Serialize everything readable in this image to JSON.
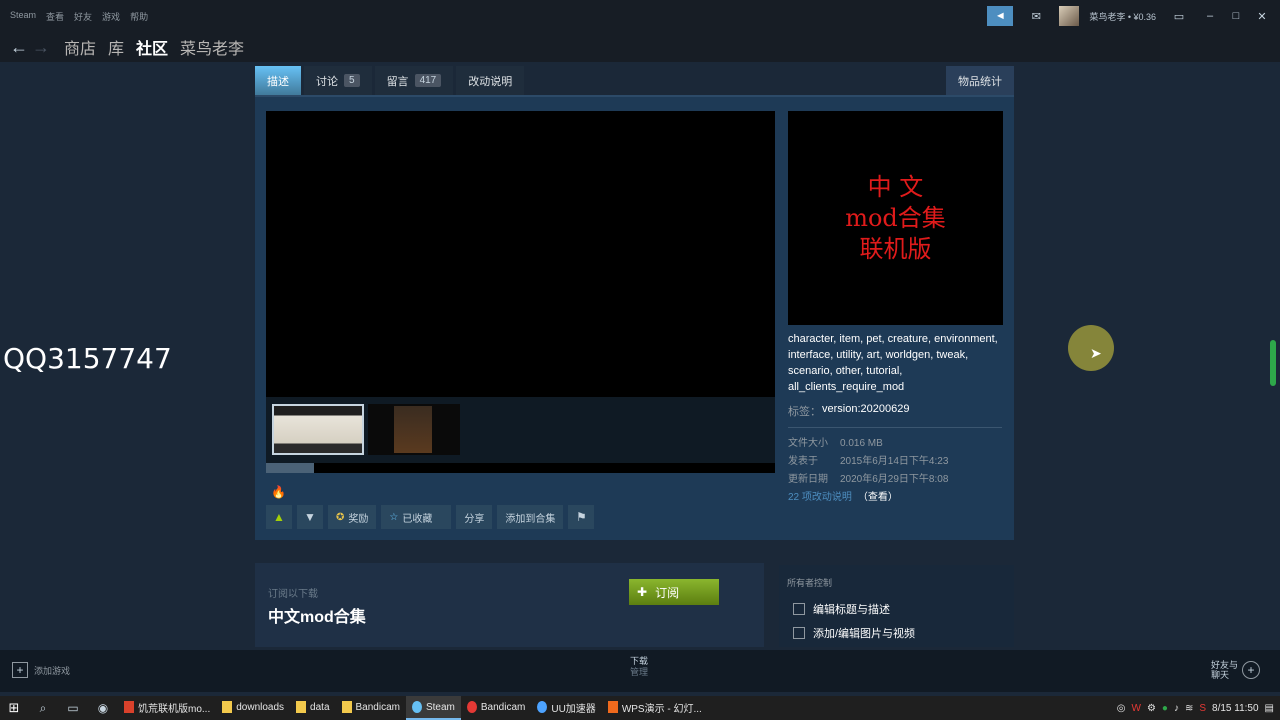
{
  "titlebar": {
    "menu": [
      "Steam",
      "查看",
      "好友",
      "游戏",
      "帮助"
    ],
    "username": "菜鸟老李 • ¥0.36",
    "icons": [
      "announce-icon",
      "mail-icon"
    ],
    "window_controls": [
      "minimize",
      "maximize",
      "close"
    ]
  },
  "nav": {
    "links": [
      "商店",
      "库",
      "社区",
      "菜鸟老李"
    ],
    "active": "社区"
  },
  "watermark": "QQ3157747",
  "tabs": {
    "describe": "描述",
    "discuss": "讨论",
    "discuss_count": "5",
    "comments": "留言",
    "comments_count": "417",
    "changes": "改动说明",
    "stats": "物品统计"
  },
  "preview": {
    "line1": "中 文",
    "line2": "mod合集",
    "line3": "联机版"
  },
  "tags": {
    "list": "character, item, pet, creature, environment, interface, utility, art, worldgen, tweak, scenario, other, tutorial, all_clients_require_mod",
    "label": "标签：",
    "value": "version:20200629"
  },
  "stats": {
    "size_label": "文件大小",
    "size_value": "0.016 MB",
    "posted_label": "发表于",
    "posted_value": "2015年6月14日下午4:23",
    "updated_label": "更新日期",
    "updated_value": "2020年6月29日下午8:08",
    "changes_link": "22 项改动说明",
    "changes_view": "（查看）"
  },
  "actions": {
    "award": "奖励",
    "favorited": "已收藏",
    "share": "分享",
    "add_collection": "添加到合集"
  },
  "subscribe": {
    "label": "订阅以下载",
    "title": "中文mod合集",
    "button": "订阅"
  },
  "owner": {
    "title": "所有者控制",
    "edit_title": "编辑标题与描述",
    "edit_media": "添加/编辑图片与视频"
  },
  "bottombar": {
    "add_game": "添加游戏",
    "download": "下载",
    "download_sub": "管理",
    "friends_line1": "好友与",
    "friends_line2": "聊天"
  },
  "taskbar": {
    "items": [
      "饥荒联机版mo...",
      "downloads",
      "data",
      "Bandicam",
      "Steam",
      "Bandicam",
      "UU加速器",
      "WPS演示 - 幻灯..."
    ],
    "clock": "8/15 11:50"
  }
}
